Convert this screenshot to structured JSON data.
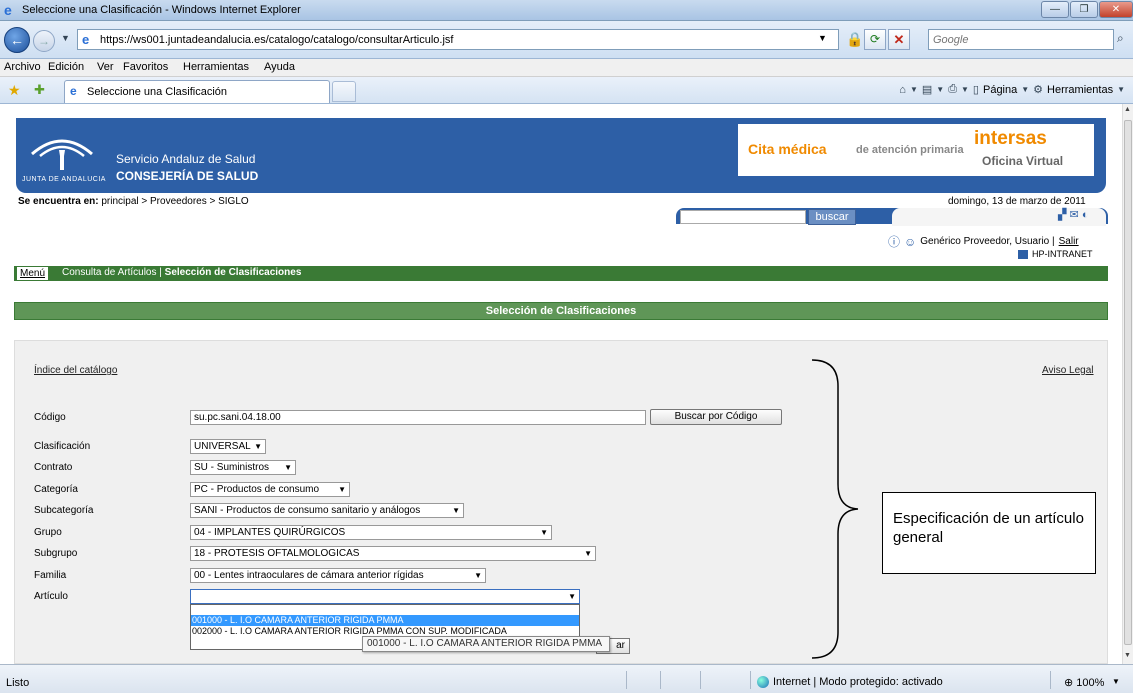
{
  "window": {
    "title": "Seleccione una Clasificación - Windows Internet Explorer"
  },
  "address": {
    "url": "https://ws001.juntadeandalucia.es/catalogo/catalogo/consultarArticulo.jsf",
    "search_placeholder": "Google"
  },
  "menu": [
    "Archivo",
    "Edición",
    "Ver",
    "Favoritos",
    "Herramientas",
    "Ayuda"
  ],
  "tab": {
    "label": "Seleccione una Clasificación"
  },
  "commandbar": {
    "page_label": "Página",
    "tools_label": "Herramientas"
  },
  "header": {
    "junta": "JUNTA DE ANDALUCIA",
    "sas": "Servicio Andaluz de Salud",
    "consejeria": "CONSEJERÍA DE SALUD",
    "cita_main": "Cita médica",
    "cita_sub": "de atención primaria",
    "intersas": "intersas",
    "oficina": "Oficina Virtual"
  },
  "breadcrumb": {
    "prefix": "Se encuentra en:",
    "path": "principal > Proveedores > SIGLO"
  },
  "date": "domingo, 13 de marzo de 2011",
  "site_search": {
    "button": "buscar"
  },
  "user": {
    "name": "Genérico Proveedor, Usuario |",
    "logout": "Salir",
    "host": "HP-INTRANET"
  },
  "nav": {
    "menu": "Menú",
    "link1": "Consulta de Artículos",
    "separator": "|",
    "current": "Selección de Clasificaciones"
  },
  "section_title": "Selección de Clasificaciones",
  "links": {
    "indice": "Índice del catálogo",
    "aviso": "Aviso Legal"
  },
  "form": {
    "codigo_label": "Código",
    "codigo_value": "su.pc.sani.04.18.00",
    "buscar_codigo": "Buscar por Código",
    "fields": [
      {
        "label": "Clasificación",
        "value": "UNIVERSAL"
      },
      {
        "label": "Contrato",
        "value": "SU - Suministros"
      },
      {
        "label": "Categoría",
        "value": "PC - Productos de consumo"
      },
      {
        "label": "Subcategoría",
        "value": "SANI - Productos de consumo sanitario y análogos"
      },
      {
        "label": "Grupo",
        "value": "04 - IMPLANTES QUIRÚRGICOS"
      },
      {
        "label": "Subgrupo",
        "value": "18 - PROTESIS OFTALMOLOGICAS"
      },
      {
        "label": "Familia",
        "value": "00 - Lentes intraoculares de cámara anterior rígidas"
      },
      {
        "label": "Artículo",
        "value": ""
      }
    ],
    "options": [
      "001000 - L. I.O CAMARA ANTERIOR RIGIDA PMMA",
      "002000 - L. I.O CAMARA ANTERIOR RIGIDA PMMA CON SUP. MODIFICADA"
    ],
    "tooltip": "001000 - L. I.O CAMARA ANTERIOR RIGIDA PMMA",
    "hidden_button_tail": "ar"
  },
  "annotation": "Especificación de un artículo general",
  "status": {
    "left": "Listo",
    "zone": "Internet | Modo protegido: activado",
    "zoom": "100%"
  }
}
